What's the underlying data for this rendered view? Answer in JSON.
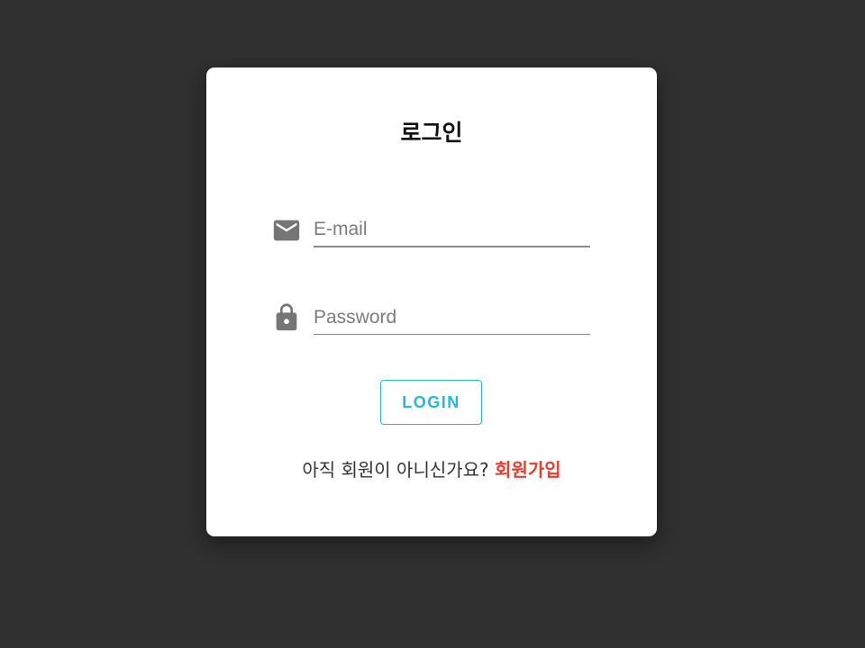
{
  "login_card": {
    "title": "로그인",
    "email": {
      "icon": "mail-icon",
      "placeholder": "E-mail",
      "value": ""
    },
    "password": {
      "icon": "lock-icon",
      "placeholder": "Password",
      "value": ""
    },
    "login_button_label": "LOGIN",
    "signup_prompt": "아직 회원이 아니신가요?",
    "signup_link_label": "회원가입"
  },
  "colors": {
    "background": "#303030",
    "card": "#ffffff",
    "accent": "#1fbcd2",
    "link": "#ef3b2c",
    "icon": "#757575"
  }
}
